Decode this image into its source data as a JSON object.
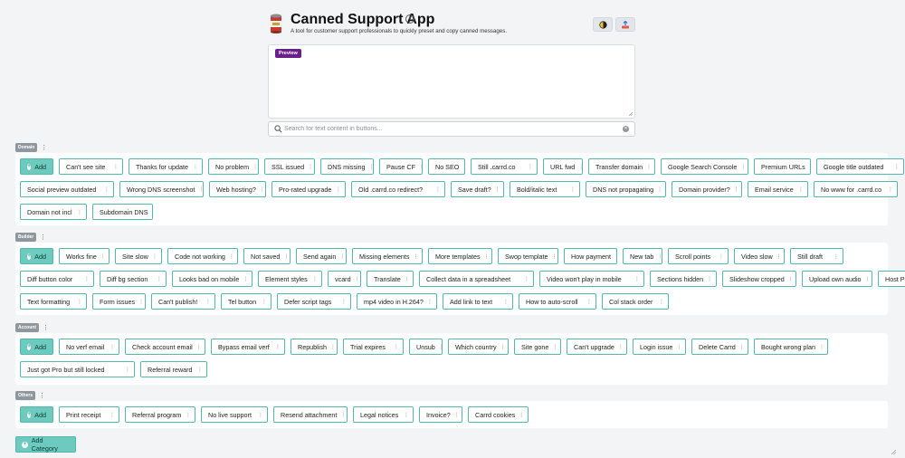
{
  "app": {
    "title": "Canned Support App",
    "subtitle": "A tool for customer support professionals to quickly preset and copy canned messages."
  },
  "preview": {
    "badge": "Preview"
  },
  "search": {
    "placeholder": "Search for text content in buttons..."
  },
  "add_label": "Add",
  "add_category_label": "Add Category",
  "colors": {
    "accent": "#6ccabf",
    "accent_border": "#52b8ae",
    "preview_badge": "#6b1f8c",
    "category_badge": "#8f969c"
  },
  "icons": [
    "info-icon",
    "theme-toggle-icon",
    "share-icon",
    "search-icon",
    "clear-icon",
    "plus-icon",
    "menu-dots-icon"
  ],
  "categories": [
    {
      "name": "Domain",
      "rows": [
        [
          "Can't see site",
          "Thanks for update",
          "No problem",
          "SSL issued",
          "DNS missing",
          "Pause CF",
          "No SEO",
          "Still .carrd.co",
          "URL fwd",
          "Transfer domain",
          "Google Search Console",
          "Premium URLs",
          "Google title outdated"
        ],
        [
          "Social preview outdated",
          "Wrong DNS screenshot",
          "Web hosting?",
          "Pro-rated upgrade",
          "Old .carrd.co redirect?",
          "Save draft?",
          "Bold/italic text",
          "DNS not propagating",
          "Domain provider?",
          "Email service",
          "No www for .carrd.co"
        ],
        [
          "Domain not incl",
          "Subdomain DNS"
        ]
      ]
    },
    {
      "name": "Builder",
      "rows": [
        [
          "Works fine",
          "Site slow",
          "Code not working",
          "Not saved",
          "Send again",
          "Missing elements",
          "More templates",
          "Swop template",
          "How payment",
          "New tab",
          "Scroll points",
          "Video slow",
          "Still draft"
        ],
        [
          "Diff button color",
          "Diff bg section",
          "Looks bad on mobile",
          "Element styles",
          "vcard",
          "Translate",
          "Collect data in a spreadsheet",
          "Video won't play in mobile",
          "Sections hidden",
          "Slideshow cropped",
          "Upload own audio",
          "Host PDFs?"
        ],
        [
          "Text formatting",
          "Form issues",
          "Can't publish!",
          "Tel button",
          "Defer script tags",
          "mp4 video in H.264?",
          "Add link to text",
          "How to auto-scroll",
          "Col stack order"
        ]
      ]
    },
    {
      "name": "Account",
      "rows": [
        [
          "No verf email",
          "Check account email",
          "Bypass email verf",
          "Republish",
          "Trial expires",
          "Unsub",
          "Which country",
          "Site gone",
          "Can't upgrade",
          "Login issue",
          "Delete Carrd",
          "Bought wrong plan"
        ],
        [
          "Just got Pro but still locked",
          "Referral reward"
        ]
      ]
    },
    {
      "name": "Others",
      "rows": [
        [
          "Print receipt",
          "Referral program",
          "No live support",
          "Resend attachment",
          "Legal notices",
          "Invoice?",
          "Carrd cookies"
        ]
      ]
    }
  ]
}
